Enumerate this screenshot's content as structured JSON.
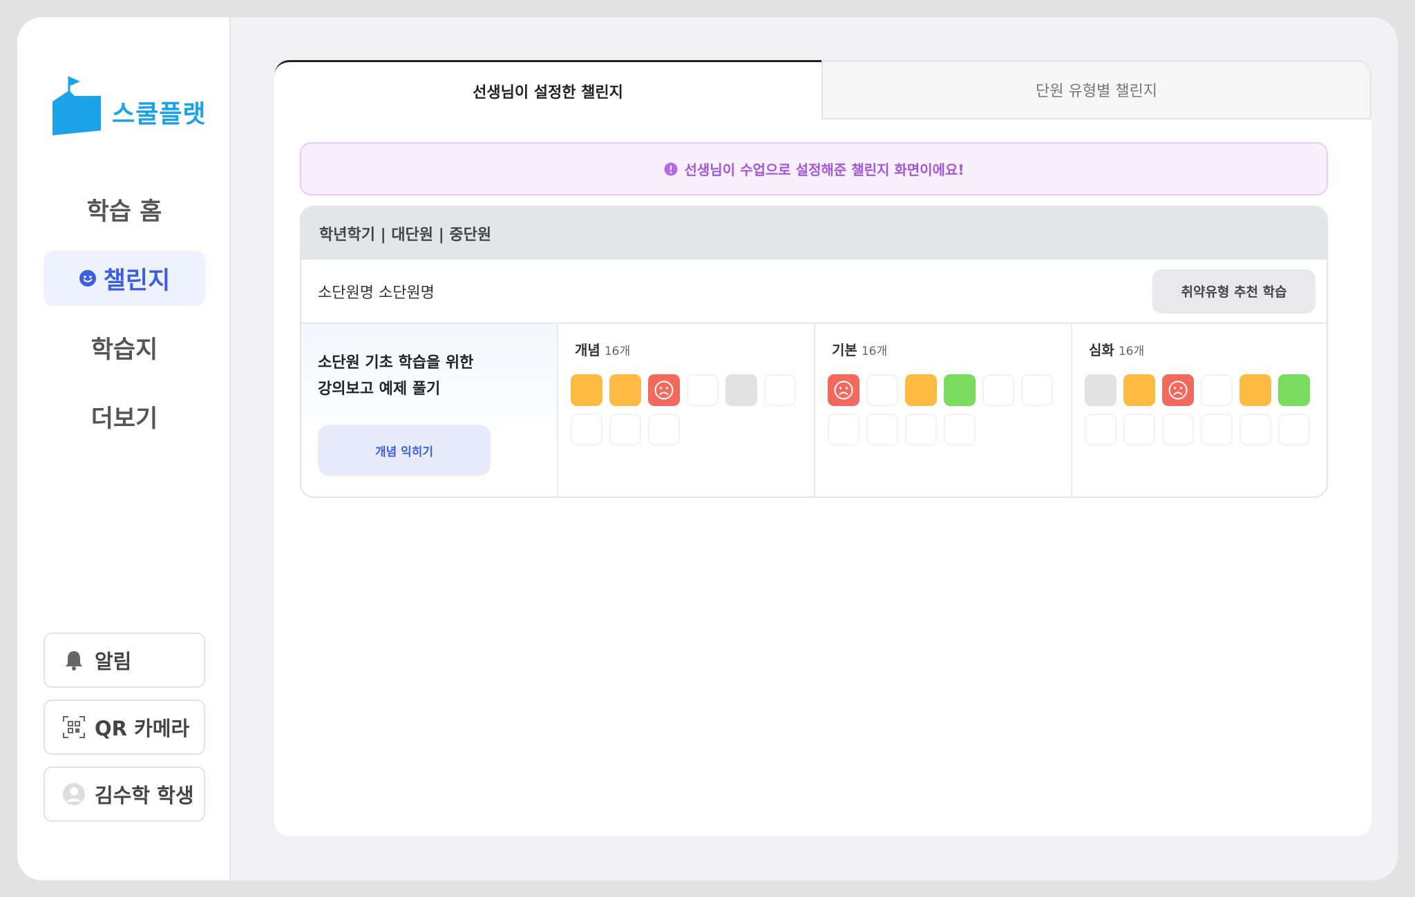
{
  "brand": {
    "name": "스쿨플랫",
    "color": "#1ba3e8"
  },
  "nav": [
    {
      "label": "학습 홈",
      "active": false
    },
    {
      "label": "챌린지",
      "active": true
    },
    {
      "label": "학습지",
      "active": false
    },
    {
      "label": "더보기",
      "active": false
    }
  ],
  "side_buttons": {
    "alarm": "알림",
    "qr": "QR 카메라",
    "profile": "김수학 학생"
  },
  "tabs": {
    "teacher": "선생님이 설정한 챌린지",
    "unit_type": "단원 유형별 챌린지"
  },
  "notice": "선생님이 수업으로 설정해준 챌린지 화면이에요!",
  "card": {
    "header": "학년학기 | 대단원 | 중단원",
    "unit_name": "소단원명 소단원명",
    "weak_button": "취약유형 추천 학습",
    "intro_desc": "소단원 기초 학습을 위한\n강의보고 예제 풀기",
    "concept_button": "개념 익히기",
    "levels": [
      {
        "title": "개념",
        "count": "16개",
        "cells": [
          "orange",
          "orange",
          "red",
          "empty",
          "gray",
          "empty",
          "empty",
          "empty",
          "empty"
        ]
      },
      {
        "title": "기본",
        "count": "16개",
        "cells": [
          "red",
          "empty",
          "orange",
          "green",
          "empty",
          "empty",
          "empty",
          "empty",
          "empty",
          "empty"
        ]
      },
      {
        "title": "심화",
        "count": "16개",
        "cells": [
          "gray",
          "orange",
          "red",
          "empty",
          "orange",
          "green",
          "empty",
          "empty",
          "empty",
          "empty",
          "empty",
          "empty"
        ]
      }
    ]
  }
}
